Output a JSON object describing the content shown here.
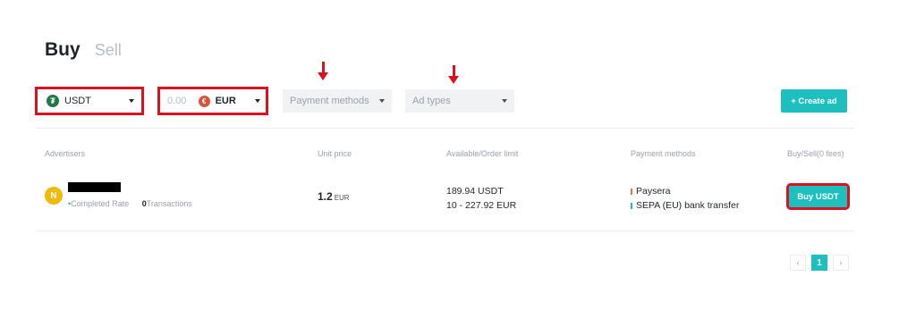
{
  "tabs": {
    "buy": "Buy",
    "sell": "Sell"
  },
  "filters": {
    "coin": {
      "icon": "tether-icon",
      "value": "USDT"
    },
    "amount": {
      "placeholder": "0.00",
      "currency_icon": "euro-icon",
      "currency": "EUR"
    },
    "payment_methods": "Payment methods",
    "ad_types": "Ad types"
  },
  "create_ad_label": "+ Create ad",
  "columns": [
    "Advertisers",
    "Unit price",
    "Available/Order limit",
    "Payment methods",
    "Buy/Sell(0 fees)"
  ],
  "listing": {
    "avatar_letter": "N",
    "completed_rate_label": "Completed Rate",
    "transactions_count": "0",
    "transactions_label": "Transactions",
    "price": "1.2",
    "price_unit": "EUR",
    "available": "189.94 USDT",
    "limit": "10 - 227.92 EUR",
    "payment_methods": [
      {
        "name": "Paysera",
        "color": "#f5742b"
      },
      {
        "name": "SEPA (EU) bank transfer",
        "color": "#1ebfbf"
      }
    ],
    "action_label": "Buy USDT"
  },
  "pagination": {
    "prev": "‹",
    "current": "1",
    "next": "›"
  },
  "colors": {
    "accent": "#1ebfbf",
    "highlight": "#d9121f"
  }
}
